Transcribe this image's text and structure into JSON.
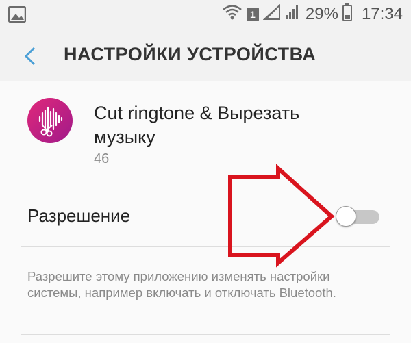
{
  "status_bar": {
    "left_icon": "image-notification-icon",
    "wifi_icon": "wifi-icon",
    "sim_badge": "1",
    "signal_icons": [
      "no-signal-icon",
      "signal-icon"
    ],
    "battery_percent": "29%",
    "battery_icon": "battery-icon",
    "time": "17:34"
  },
  "header": {
    "back_icon": "chevron-left-icon",
    "title": "НАСТРОЙКИ УСТРОЙСТВА"
  },
  "app": {
    "icon": "audio-waveform-scissors-icon",
    "name": "Cut ringtone & Вырезать музыку",
    "version": "46"
  },
  "permission": {
    "label": "Разрешение",
    "enabled": false,
    "description": "Разрешите этому приложению изменять настройки системы, например включать и отключать Bluetooth."
  },
  "colors": {
    "accent": "#4a9fd6",
    "app_icon_start": "#e0287a",
    "app_icon_end": "#a01a8a",
    "annotation_arrow": "#d9141e",
    "toggle_track_off": "#c7c7c7"
  },
  "annotation": {
    "arrow_icon": "red-arrow-pointing-right"
  }
}
